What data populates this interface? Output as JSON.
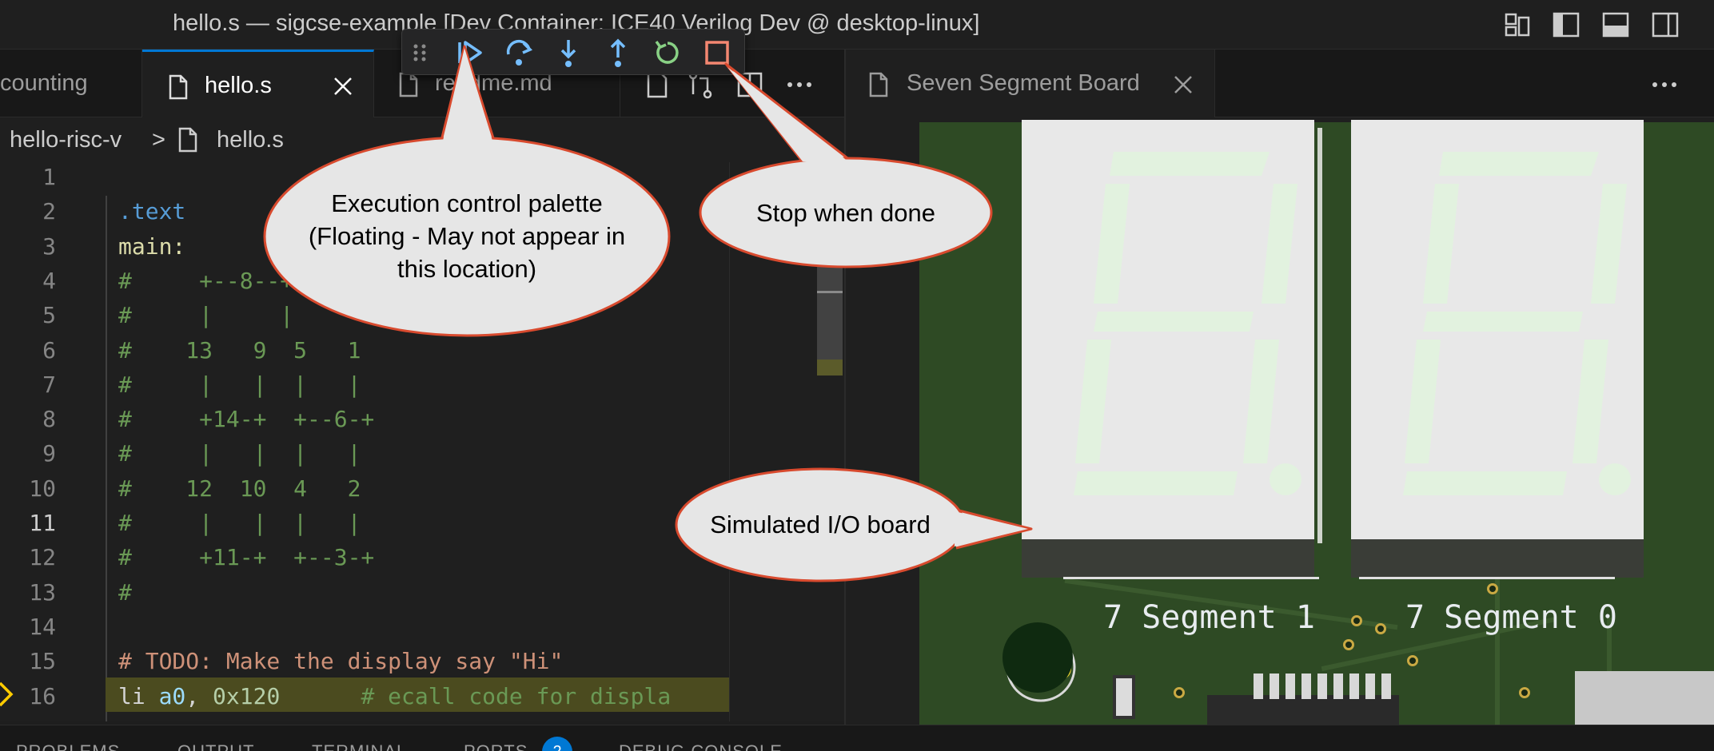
{
  "window": {
    "title": "hello.s — sigcse-example [Dev Container: ICE40 Verilog Dev @ desktop-linux]"
  },
  "editor_left": {
    "tabs": [
      {
        "label": "counting",
        "active": false
      },
      {
        "label": "hello.s",
        "active": true
      },
      {
        "label": "readme.md",
        "active": false
      }
    ],
    "breadcrumb": {
      "folder": "hello-risc-v",
      "separator": ">",
      "file": "hello.s"
    },
    "current_line": 11,
    "lines": [
      {
        "n": "1",
        "text": ""
      },
      {
        "n": "2",
        "text": ".text"
      },
      {
        "n": "3",
        "text": "main:"
      },
      {
        "n": "4",
        "text": "   #     +--8--+"
      },
      {
        "n": "5",
        "text": "   #     |     |"
      },
      {
        "n": "6",
        "text": "   #    13   9  5   1"
      },
      {
        "n": "7",
        "text": "   #     |   |  |   |"
      },
      {
        "n": "8",
        "text": "   #     +14-+  +--6-+"
      },
      {
        "n": "9",
        "text": "   #     |   |  |   |"
      },
      {
        "n": "10",
        "text": "   #    12  10  4   2"
      },
      {
        "n": "11",
        "text": "   #     |   |  |   |"
      },
      {
        "n": "12",
        "text": "   #     +11-+  +--3-+"
      },
      {
        "n": "13",
        "text": "   #"
      },
      {
        "n": "14",
        "text": ""
      },
      {
        "n": "15",
        "text": "   # TODO: Make the display say \"Hi\""
      },
      {
        "n": "16",
        "text": "   li a0, 0x120      # ecall code for displa"
      }
    ]
  },
  "editor_right": {
    "tab_label": "Seven Segment Board",
    "segment_labels": [
      "7 Segment 1",
      "7 Segment 0"
    ]
  },
  "panel": {
    "tabs": [
      "PROBLEMS",
      "OUTPUT",
      "TERMINAL",
      "PORTS",
      "DEBUG CONSOLE"
    ],
    "ports_count": "2"
  },
  "debug_toolbar": {
    "buttons": [
      "drag-handle",
      "continue",
      "step-over",
      "step-into",
      "step-out",
      "restart",
      "stop"
    ]
  },
  "callouts": {
    "palette": "Execution control palette (Floating - May not appear in this location)",
    "palette_lines": [
      "Execution control palette",
      "(Floating - May not appear in",
      "this location)"
    ],
    "stop": "Stop when done",
    "board": "Simulated I/O board"
  },
  "colors": {
    "accent": "#0078d4",
    "callout_fill": "#e6e6e6",
    "callout_stroke": "#d84a2e",
    "comment": "#6a9955",
    "todo": "#ce9178",
    "directive": "#569cd6",
    "label": "#dcdcaa",
    "pcb": "#2e4a24"
  }
}
